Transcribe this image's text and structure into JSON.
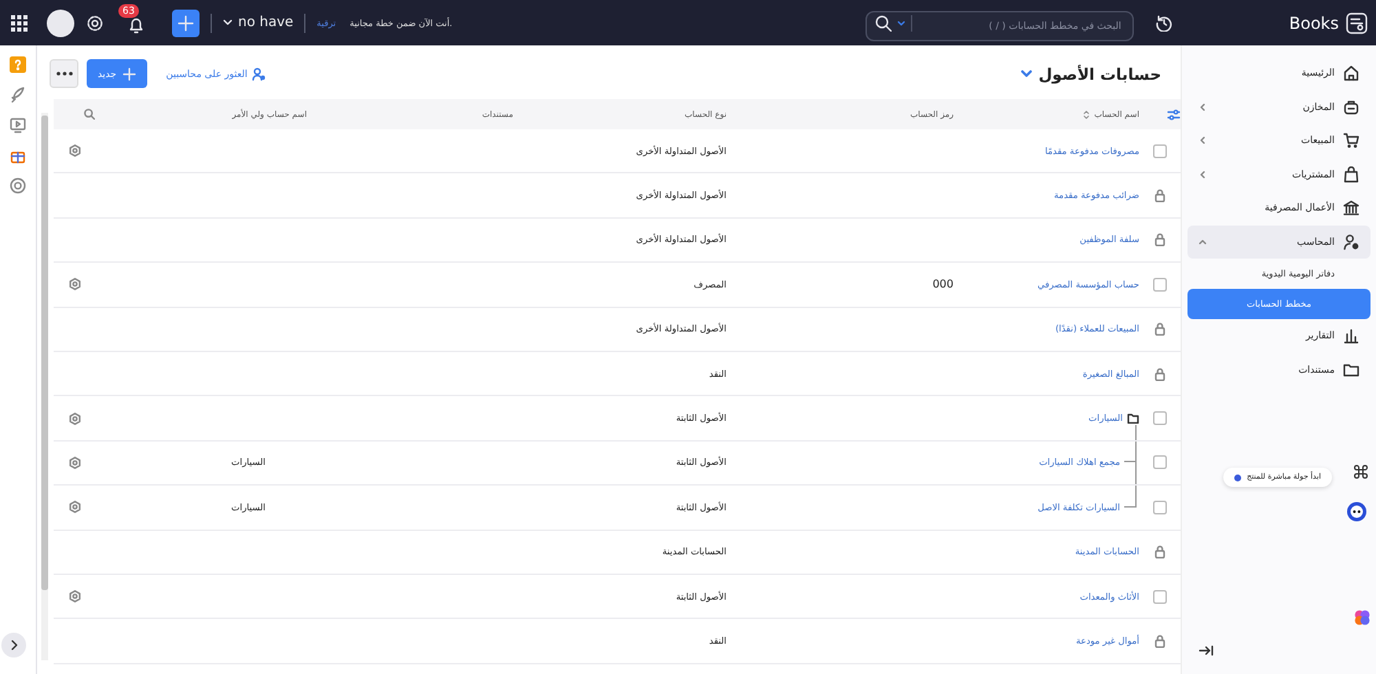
{
  "app": {
    "name": "Books"
  },
  "topbar": {
    "search": {
      "placeholder": "البحث في مخطط الحسابات ( / )"
    },
    "plan_notice": "أنت الآن ضمن خطة مجانية.",
    "upgrade_link": "ترقية",
    "organization": "no have",
    "notifications": "63"
  },
  "sidebar": {
    "items": [
      {
        "label": "الرئيسية",
        "kind": "link",
        "selected": false
      },
      {
        "label": "المخازن",
        "kind": "group",
        "expanded": false
      },
      {
        "label": "المبيعات",
        "kind": "group",
        "expanded": false
      },
      {
        "label": "المشتريات",
        "kind": "group",
        "expanded": false
      },
      {
        "label": "الأعمال المصرفية",
        "kind": "link",
        "selected": false
      },
      {
        "label": "المحاسب",
        "kind": "group",
        "expanded": true,
        "children": [
          {
            "label": "دفاتر اليومية اليدوية",
            "selected": false
          },
          {
            "label": "مخطط الحسابات",
            "selected": true
          }
        ]
      },
      {
        "label": "التقارير",
        "kind": "link",
        "selected": false
      },
      {
        "label": "مستندات",
        "kind": "link",
        "selected": false
      }
    ]
  },
  "page": {
    "title": "حسابات الأصول",
    "find_accountants": "العثور على محاسبين",
    "new_button": "جديد"
  },
  "tour": {
    "label": "ابدأ جولة مباشرة للمنتج"
  },
  "table": {
    "columns": [
      "اسم الحساب",
      "رمز الحساب",
      "نوع الحساب",
      "مستندات",
      "اسم حساب ولي الأمر"
    ],
    "rows": [
      {
        "name": "مصروفات مدفوعة مقدمًا",
        "type": "الأصول المتداولة الأخرى",
        "locked": false,
        "selected": false
      },
      {
        "name": "ضرائب مدفوعة مقدمة",
        "type": "الأصول المتداولة الأخرى",
        "locked": true,
        "selected": false
      },
      {
        "name": "سلفة الموظفين",
        "type": "الأصول المتداولة الأخرى",
        "locked": true,
        "selected": false
      },
      {
        "name": "حساب المؤسسة المصرفي",
        "code": "000",
        "type": "المصرف",
        "locked": false,
        "selected": false
      },
      {
        "name": "المبيعات للعملاء (نقدًا)",
        "type": "الأصول المتداولة الأخرى",
        "locked": true,
        "selected": false
      },
      {
        "name": "المبالغ الصغيرة",
        "type": "النقد",
        "locked": true,
        "selected": false
      },
      {
        "name": "السيارات",
        "type": "الأصول الثابتة",
        "locked": false,
        "selected": false,
        "children": [
          {
            "name": "مجمع اهلاك السيارات",
            "type": "الأصول الثابتة",
            "parent": "السيارات",
            "locked": false,
            "selected": false
          },
          {
            "name": "السيارات تكلفة الاصل",
            "type": "الأصول الثابتة",
            "parent": "السيارات",
            "locked": false,
            "selected": false
          }
        ]
      },
      {
        "name": "الحسابات المدينة",
        "type": "الحسابات المدينة",
        "locked": true,
        "selected": false
      },
      {
        "name": "الأثاث والمعدات",
        "type": "الأصول الثابتة",
        "locked": false,
        "selected": false
      },
      {
        "name": "أموال غير مودعة",
        "type": "النقد",
        "locked": true,
        "selected": false
      }
    ]
  }
}
